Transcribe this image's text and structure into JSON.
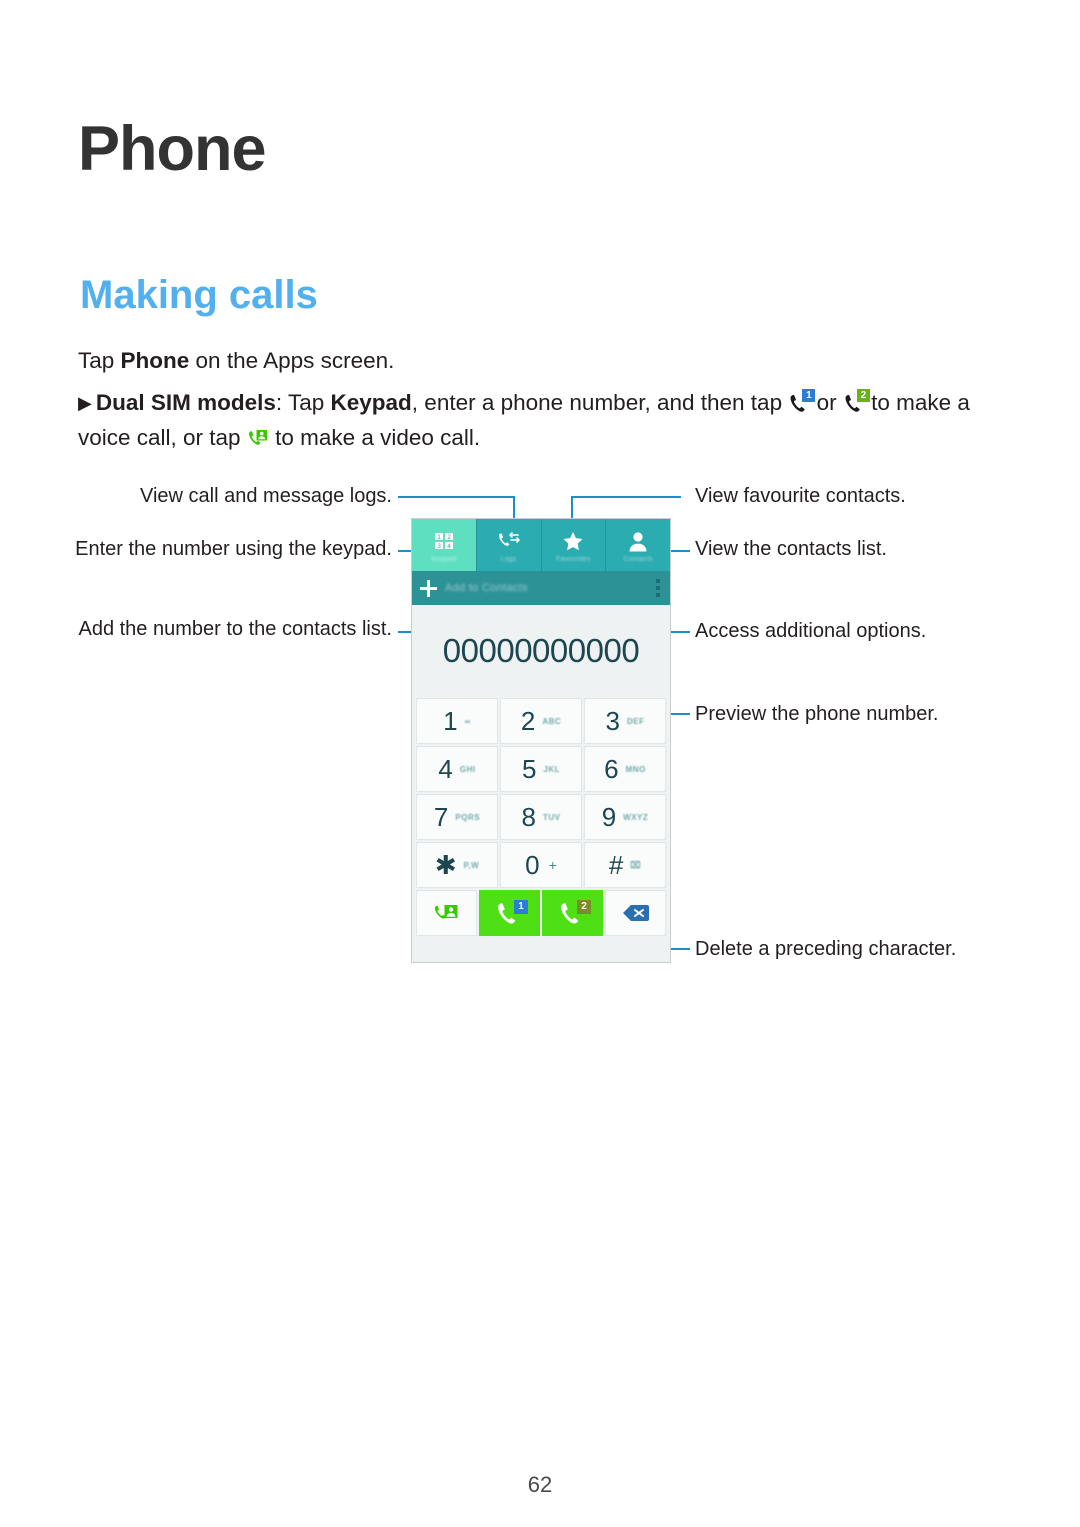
{
  "document": {
    "chapter_title": "Phone",
    "section_title": "Making calls",
    "page_number": "62"
  },
  "body": {
    "line1_pre": "Tap ",
    "line1_bold": "Phone",
    "line1_post": " on the Apps screen.",
    "bullet_marker": "▶",
    "bullet_bold_1": "Dual SIM models",
    "bullet_text_1": ": Tap ",
    "bullet_bold_2": "Keypad",
    "bullet_text_2": ", enter a phone number, and then tap ",
    "bullet_text_3": " or ",
    "bullet_text_4": " to make a voice call, or tap ",
    "bullet_text_5": " to make a video call.",
    "sim1_badge": "1",
    "sim2_badge": "2"
  },
  "annotations": {
    "view_logs": "View call and message logs.",
    "enter_number": "Enter the number using the keypad.",
    "add_contacts": "Add the number to the contacts list.",
    "view_favourites": "View favourite contacts.",
    "view_contacts": "View the contacts list.",
    "access_options": "Access additional options.",
    "preview_number": "Preview the phone number.",
    "delete_character": "Delete a preceding character."
  },
  "phone_screen": {
    "tabs": [
      {
        "label": "Keypad",
        "icon": "keypad-icon",
        "active": true
      },
      {
        "label": "Logs",
        "icon": "call-log-icon",
        "active": false
      },
      {
        "label": "Favourites",
        "icon": "star-icon",
        "active": false
      },
      {
        "label": "Contacts",
        "icon": "person-icon",
        "active": false
      }
    ],
    "add_to_contacts_label": "Add to Contacts",
    "more_options_icon": "overflow-menu-icon",
    "phone_number": "00000000000",
    "keys": [
      [
        {
          "digit": "1",
          "sub": "∞",
          "type": "voicemail"
        },
        {
          "digit": "2",
          "sub": "ABC",
          "type": "letters"
        },
        {
          "digit": "3",
          "sub": "DEF",
          "type": "letters"
        }
      ],
      [
        {
          "digit": "4",
          "sub": "GHI",
          "type": "letters"
        },
        {
          "digit": "5",
          "sub": "JKL",
          "type": "letters"
        },
        {
          "digit": "6",
          "sub": "MNO",
          "type": "letters"
        }
      ],
      [
        {
          "digit": "7",
          "sub": "PQRS",
          "type": "letters"
        },
        {
          "digit": "8",
          "sub": "TUV",
          "type": "letters"
        },
        {
          "digit": "9",
          "sub": "WXYZ",
          "type": "letters"
        }
      ],
      [
        {
          "digit": "✱",
          "sub": "P,W",
          "type": "letters"
        },
        {
          "digit": "0",
          "sub": "+",
          "type": "plus"
        },
        {
          "digit": "#",
          "sub": "⌧",
          "type": "symbol"
        }
      ]
    ],
    "actions": [
      {
        "name": "video-call-button",
        "label": ""
      },
      {
        "name": "call-sim1-button",
        "badge": "1"
      },
      {
        "name": "call-sim2-button",
        "badge": "2"
      },
      {
        "name": "backspace-button",
        "label": ""
      }
    ]
  },
  "colors": {
    "section_accent": "#52b0ee",
    "leader_line": "#1c8fc9",
    "tab_active": "#5ddfc0",
    "tab_inactive": "#2aacb0",
    "addbar": "#2d9296",
    "screen_bg": "#eef2f3",
    "number_text": "#1d4650",
    "call_green": "#4ee014",
    "sim1_badge": "#2a7fd4",
    "sim2_badge": "#7a8d2a",
    "backspace_blue": "#2a6fb0"
  }
}
